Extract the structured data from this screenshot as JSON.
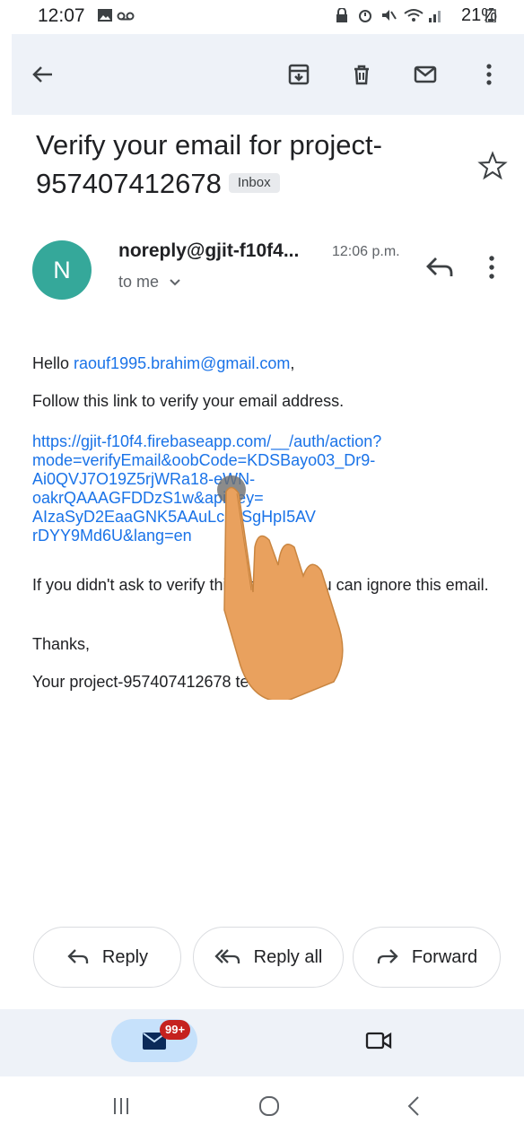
{
  "status_bar": {
    "time": "12:07",
    "battery_percent": "21%",
    "icons": [
      "gallery-icon",
      "voicemail-icon",
      "lock-icon",
      "alarm-icon",
      "mute-icon",
      "wifi-icon",
      "signal-icon",
      "battery-icon"
    ]
  },
  "toolbar": {
    "icons": [
      "back-arrow-icon",
      "archive-icon",
      "delete-icon",
      "mail-icon",
      "more-vert-icon"
    ]
  },
  "email": {
    "subject": "Verify your email for project-957407412678",
    "label": "Inbox",
    "sender": "noreply@gjit-f10f4...",
    "time": "12:06 p.m.",
    "recipient": "to me",
    "avatar_letter": "N",
    "avatar_color": "#35a89a"
  },
  "body": {
    "greeting_prefix": "Hello ",
    "greeting_email": "raouf1995.brahim@gmail.com",
    "greeting_suffix": ",",
    "instruction": "Follow this link to verify your email address.",
    "link_lines": [
      "https://gjit-f10f4.firebaseapp.com/__/auth/action?",
      "mode=verifyEmail&oobCode=KDSBayo03_Dr9-",
      "Ai0QVJ7O19Z5rjWRa18-eWN-",
      "oakrQAAAGFDDzS1w&apiKey=",
      "AIzaSyD2EaaGNK5AAuLcz8SgHpI5AV",
      "rDYY9Md6U&lang=en"
    ],
    "ignore_text": "If you didn't ask to verify this address, you can ignore this email.",
    "thanks": "Thanks,",
    "signature": "Your project-957407412678 team"
  },
  "actions": {
    "reply": "Reply",
    "reply_all": "Reply all",
    "forward": "Forward"
  },
  "bottom_nav": {
    "mail_badge": "99+",
    "items": [
      "mail-icon",
      "video-icon"
    ]
  },
  "colors": {
    "accent_link": "#1a73e8",
    "toolbar_bg": "#eef2f8",
    "badge_red": "#c5221f"
  }
}
